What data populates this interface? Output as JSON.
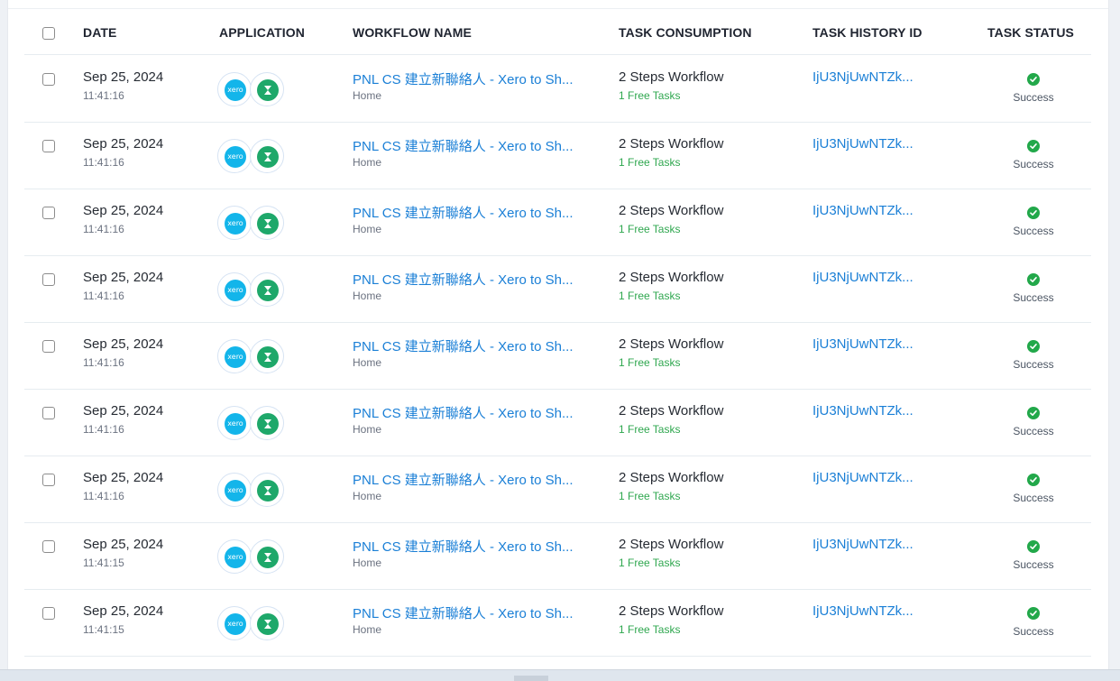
{
  "header": {
    "date": "DATE",
    "application": "APPLICATION",
    "workflow_name": "WORKFLOW NAME",
    "task_consumption": "TASK CONSUMPTION",
    "task_history_id": "TASK HISTORY ID",
    "task_status": "TASK STATUS"
  },
  "icons": {
    "app1": "xero-icon",
    "app2": "hourglass-app-icon",
    "status": "check-circle-icon"
  },
  "colors": {
    "link": "#1a7fd6",
    "success": "#22a84a",
    "free_tasks": "#2fa74f",
    "xero": "#13b5ea",
    "app2": "#1ea86a"
  },
  "app1_logo_text": "xero",
  "rows": [
    {
      "date": "Sep 25, 2024",
      "time": "11:41:16",
      "workflow": "PNL CS 建立新聯絡人 - Xero to Sh...",
      "folder": "Home",
      "consumption": "2 Steps Workflow",
      "free_tasks": "1 Free Tasks",
      "history_id": "IjU3NjUwNTZk...",
      "status": "Success"
    },
    {
      "date": "Sep 25, 2024",
      "time": "11:41:16",
      "workflow": "PNL CS 建立新聯絡人 - Xero to Sh...",
      "folder": "Home",
      "consumption": "2 Steps Workflow",
      "free_tasks": "1 Free Tasks",
      "history_id": "IjU3NjUwNTZk...",
      "status": "Success"
    },
    {
      "date": "Sep 25, 2024",
      "time": "11:41:16",
      "workflow": "PNL CS 建立新聯絡人 - Xero to Sh...",
      "folder": "Home",
      "consumption": "2 Steps Workflow",
      "free_tasks": "1 Free Tasks",
      "history_id": "IjU3NjUwNTZk...",
      "status": "Success"
    },
    {
      "date": "Sep 25, 2024",
      "time": "11:41:16",
      "workflow": "PNL CS 建立新聯絡人 - Xero to Sh...",
      "folder": "Home",
      "consumption": "2 Steps Workflow",
      "free_tasks": "1 Free Tasks",
      "history_id": "IjU3NjUwNTZk...",
      "status": "Success"
    },
    {
      "date": "Sep 25, 2024",
      "time": "11:41:16",
      "workflow": "PNL CS 建立新聯絡人 - Xero to Sh...",
      "folder": "Home",
      "consumption": "2 Steps Workflow",
      "free_tasks": "1 Free Tasks",
      "history_id": "IjU3NjUwNTZk...",
      "status": "Success"
    },
    {
      "date": "Sep 25, 2024",
      "time": "11:41:16",
      "workflow": "PNL CS 建立新聯絡人 - Xero to Sh...",
      "folder": "Home",
      "consumption": "2 Steps Workflow",
      "free_tasks": "1 Free Tasks",
      "history_id": "IjU3NjUwNTZk...",
      "status": "Success"
    },
    {
      "date": "Sep 25, 2024",
      "time": "11:41:16",
      "workflow": "PNL CS 建立新聯絡人 - Xero to Sh...",
      "folder": "Home",
      "consumption": "2 Steps Workflow",
      "free_tasks": "1 Free Tasks",
      "history_id": "IjU3NjUwNTZk...",
      "status": "Success"
    },
    {
      "date": "Sep 25, 2024",
      "time": "11:41:15",
      "workflow": "PNL CS 建立新聯絡人 - Xero to Sh...",
      "folder": "Home",
      "consumption": "2 Steps Workflow",
      "free_tasks": "1 Free Tasks",
      "history_id": "IjU3NjUwNTZk...",
      "status": "Success"
    },
    {
      "date": "Sep 25, 2024",
      "time": "11:41:15",
      "workflow": "PNL CS 建立新聯絡人 - Xero to Sh...",
      "folder": "Home",
      "consumption": "2 Steps Workflow",
      "free_tasks": "1 Free Tasks",
      "history_id": "IjU3NjUwNTZk...",
      "status": "Success"
    }
  ]
}
